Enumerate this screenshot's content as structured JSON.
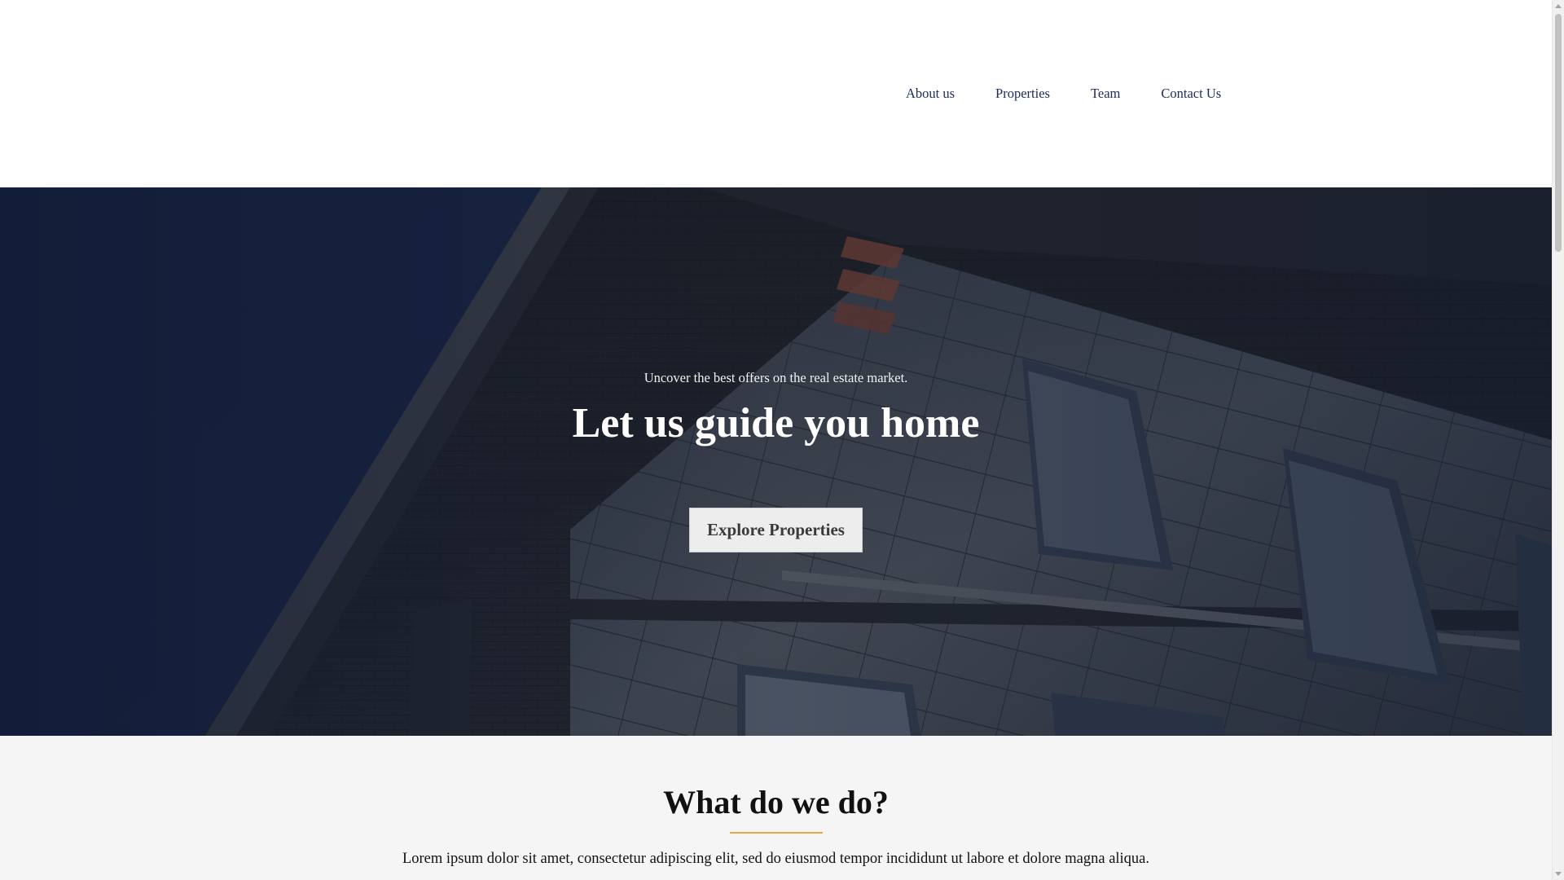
{
  "nav": {
    "items": [
      {
        "label": "About us"
      },
      {
        "label": "Properties"
      },
      {
        "label": "Team"
      },
      {
        "label": "Contact Us"
      }
    ]
  },
  "hero": {
    "tagline": "Uncover the best offers on the real estate market.",
    "title": "Let us guide you home",
    "cta_label": "Explore Properties"
  },
  "what_we_do": {
    "title": "What do we do?",
    "text": "Lorem ipsum dolor sit amet, consectetur adipiscing elit, sed do eiusmod tempor incididunt ut labore et dolore magna aliqua."
  },
  "colors": {
    "nav_text": "#1c2b57",
    "accent_divider": "#e8a93f",
    "hero_overlay": "#1b2a52"
  }
}
